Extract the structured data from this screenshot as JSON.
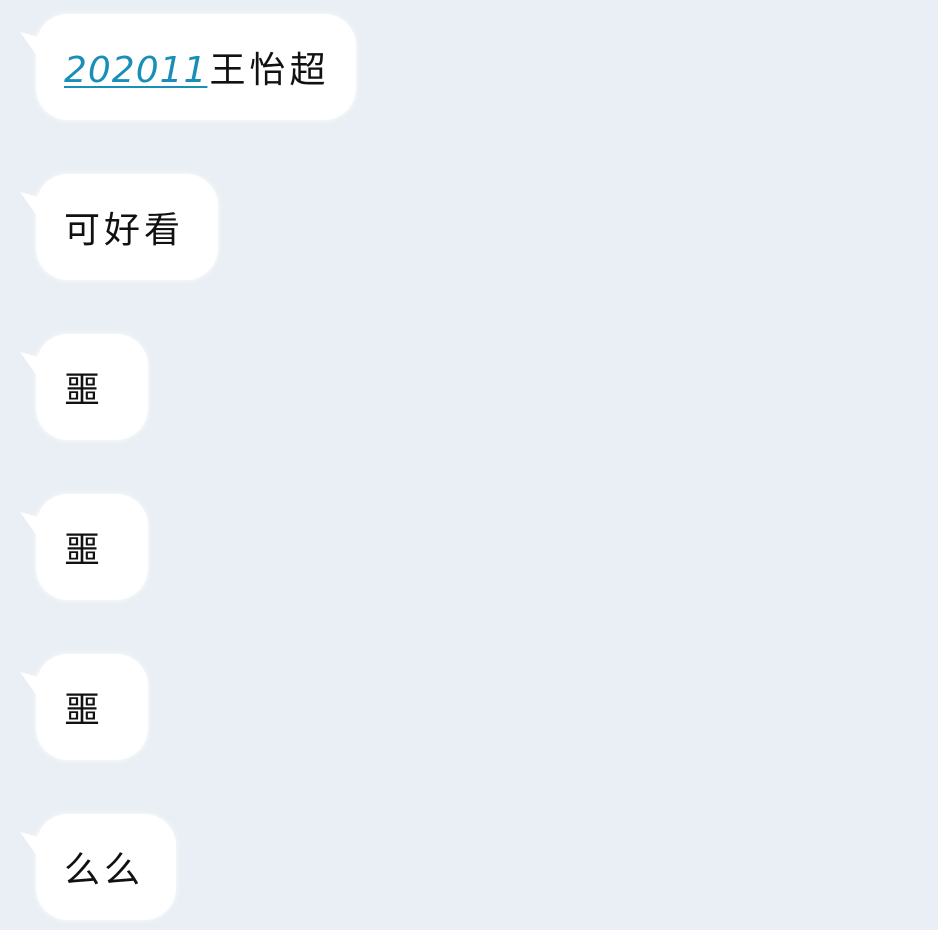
{
  "messages": [
    {
      "link_text": "202011",
      "text": "王怡超"
    },
    {
      "text": "可好看"
    },
    {
      "text": "噩"
    },
    {
      "text": "噩"
    },
    {
      "text": "噩"
    },
    {
      "text": "么么"
    }
  ],
  "colors": {
    "background": "#e9eff4",
    "bubble": "#ffffff",
    "link": "#1a8fb6",
    "text": "#111111"
  }
}
